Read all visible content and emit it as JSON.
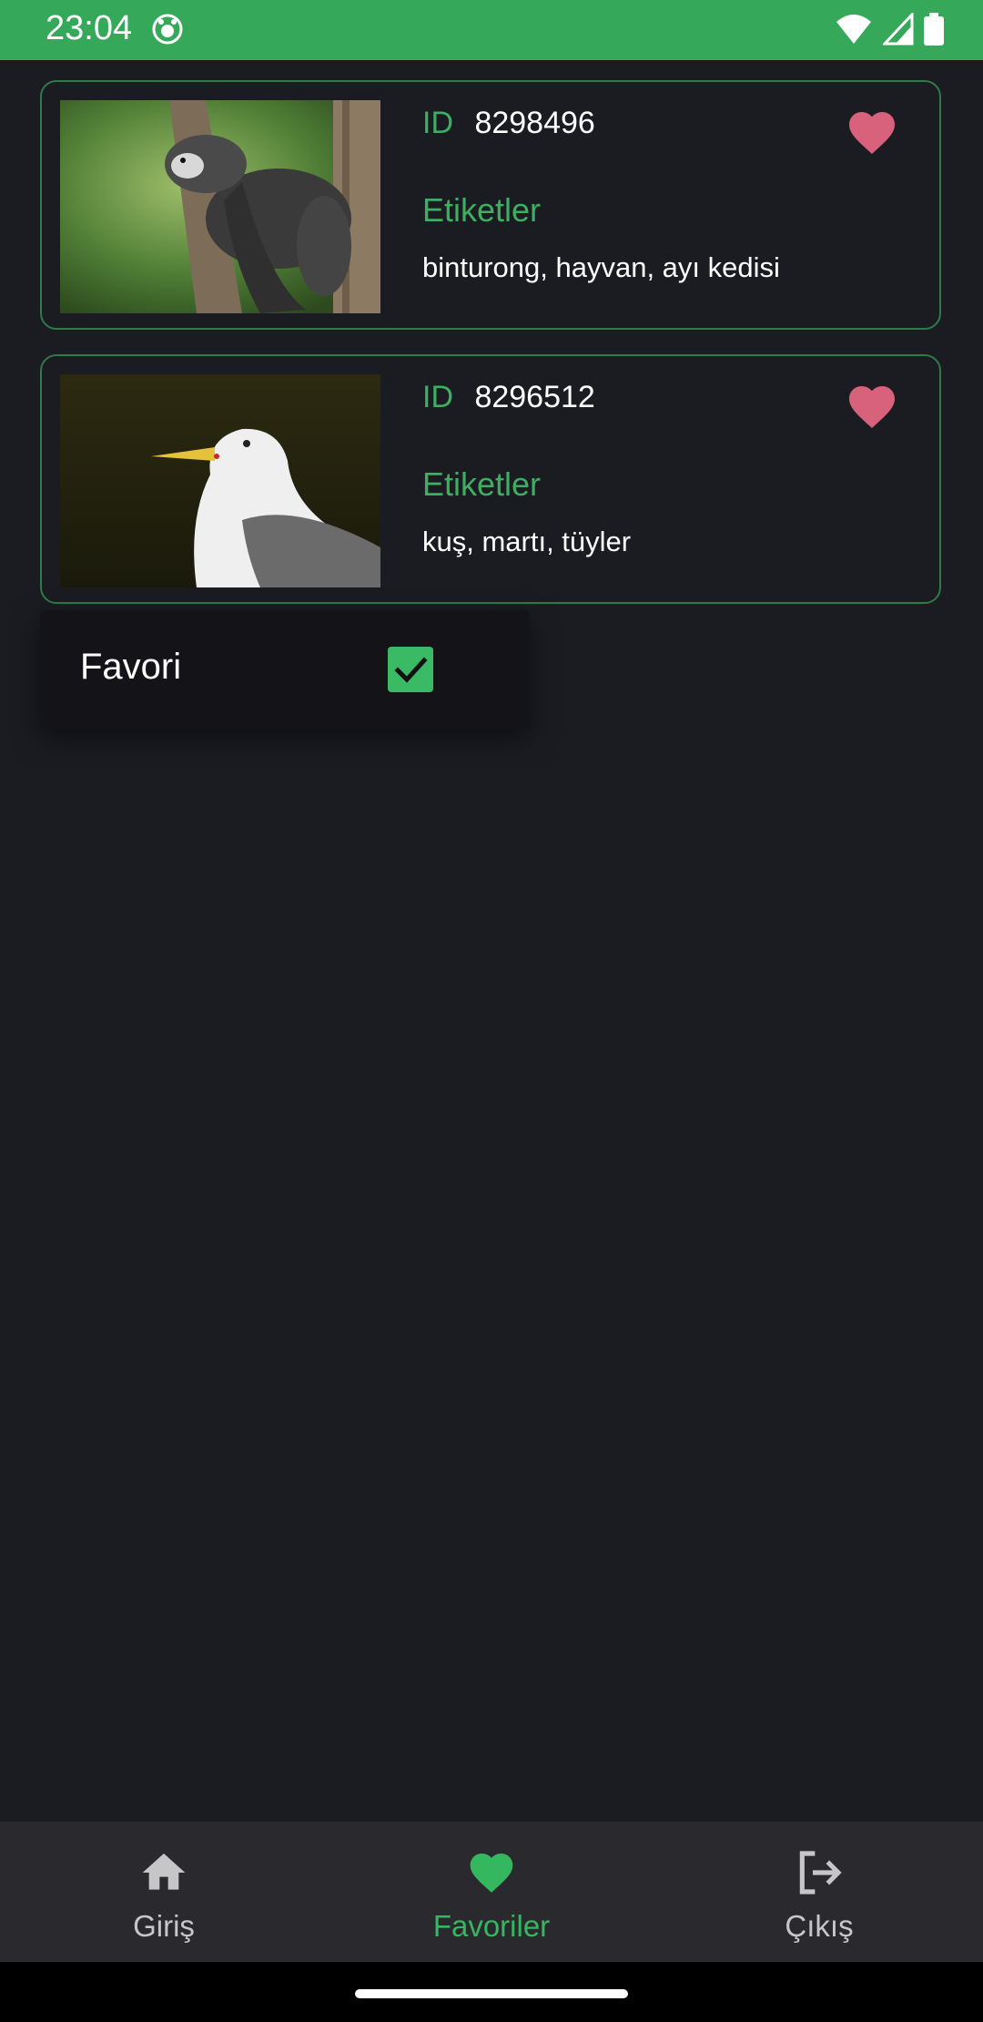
{
  "status_bar": {
    "time": "23:04",
    "background": "#35a85a"
  },
  "cards": [
    {
      "id_label": "ID",
      "id_value": "8298496",
      "tags_title": "Etiketler",
      "tags": "binturong, hayvan, ayı kedisi",
      "image_icon": "binturong-photo",
      "favorite_color": "#d8627c"
    },
    {
      "id_label": "ID",
      "id_value": "8296512",
      "tags_title": "Etiketler",
      "tags": "kuş, martı, tüyler",
      "image_icon": "seagull-photo",
      "favorite_color": "#d8627c"
    }
  ],
  "dropdown": {
    "label": "Favori",
    "checked": true
  },
  "bottom_nav": {
    "items": [
      {
        "label": "Giriş",
        "icon": "home-icon",
        "active": false
      },
      {
        "label": "Favoriler",
        "icon": "heart-icon",
        "active": true
      },
      {
        "label": "Çıkış",
        "icon": "logout-icon",
        "active": false
      }
    ],
    "active_color": "#35b760"
  },
  "accent": "#3dae62"
}
